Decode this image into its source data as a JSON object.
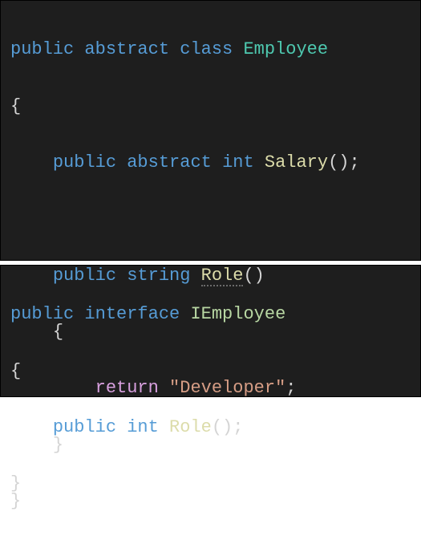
{
  "block1": {
    "l1": {
      "t1": "public",
      "t2": "abstract",
      "t3": "class",
      "t4": "Employee"
    },
    "l2": "{",
    "l3": {
      "t1": "public",
      "t2": "abstract",
      "t3": "int",
      "t4": "Salary",
      "t5": "();"
    },
    "l4": "",
    "l5": {
      "t1": "public",
      "t2": "string",
      "t3": "Role",
      "t4": "()"
    },
    "l6": "{",
    "l7": {
      "t1": "return",
      "t2": "\"Developer\"",
      "t3": ";"
    },
    "l8": "}",
    "l9": "}"
  },
  "block2": {
    "l1": {
      "t1": "public",
      "t2": "interface",
      "t3": "IEmployee"
    },
    "l2": "{",
    "l3": {
      "t1": "public",
      "t2": "int",
      "t3": "Role",
      "t4": "();"
    },
    "l4": "}"
  }
}
